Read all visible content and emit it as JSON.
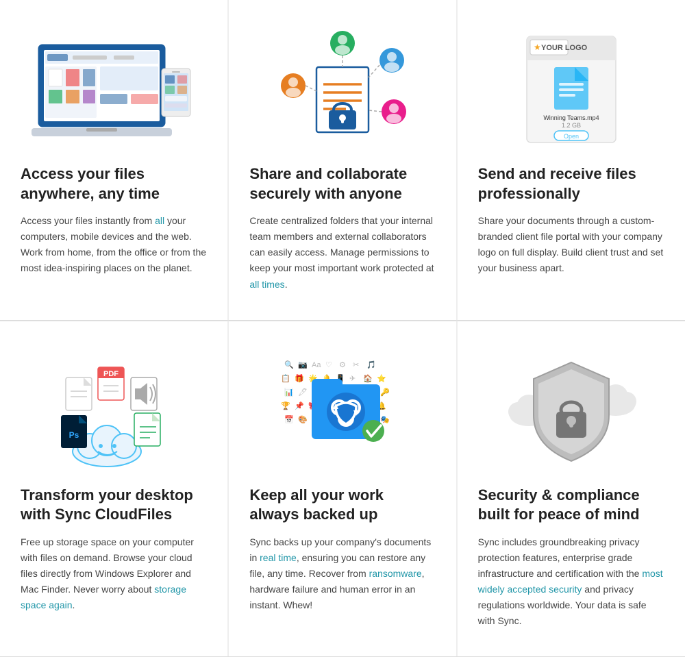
{
  "rows": [
    {
      "cells": [
        {
          "id": "access-files",
          "title": "Access your files anywhere, any time",
          "body_parts": [
            {
              "text": "Access your files instantly from ",
              "plain": true
            },
            {
              "text": "all",
              "highlight": true
            },
            {
              "text": " your computers, mobile devices and the web. Work from home, from the office or from the most idea-inspiring places on the planet.",
              "plain": true
            }
          ]
        },
        {
          "id": "share-collaborate",
          "title": "Share and collaborate securely with anyone",
          "body_parts": [
            {
              "text": "Create centralized folders that your internal team members and external collaborators can easily access. Manage permissions to keep your most important work protected at ",
              "plain": true
            },
            {
              "text": "all times",
              "highlight": true
            },
            {
              "text": ".",
              "plain": true
            }
          ]
        },
        {
          "id": "send-receive",
          "title": "Send and receive files professionally",
          "body_parts": [
            {
              "text": "Share your documents through a custom-branded client file portal with your company logo on full display. Build client trust and set your business apart.",
              "plain": true
            }
          ]
        }
      ]
    },
    {
      "cells": [
        {
          "id": "transform-desktop",
          "title": "Transform your desktop with Sync CloudFiles",
          "body_parts": [
            {
              "text": "Free up storage space on your computer with files on demand. Browse your cloud files directly from Windows Explorer and Mac Finder. Never worry about ",
              "plain": true
            },
            {
              "text": "storage space again",
              "highlight": true
            },
            {
              "text": ".",
              "plain": true
            }
          ]
        },
        {
          "id": "keep-work",
          "title": "Keep all your work always backed up",
          "body_parts": [
            {
              "text": "Sync backs up your company's documents in ",
              "plain": true
            },
            {
              "text": "real time",
              "highlight": true
            },
            {
              "text": ", ensuring you can restore any file, any time. Recover from ",
              "plain": true
            },
            {
              "text": "ransomware",
              "highlight": true
            },
            {
              "text": ", hardware failure and human error in an instant. Whew!",
              "plain": true
            }
          ]
        },
        {
          "id": "security-compliance",
          "title": "Security & compliance built for peace of mind",
          "body_parts": [
            {
              "text": "Sync includes groundbreaking privacy protection features, enterprise grade infrastructure and certification with the ",
              "plain": true
            },
            {
              "text": "most widely accepted security",
              "highlight": true
            },
            {
              "text": " and privacy regulations worldwide. Your data is safe with Sync.",
              "plain": true
            }
          ]
        }
      ]
    }
  ]
}
